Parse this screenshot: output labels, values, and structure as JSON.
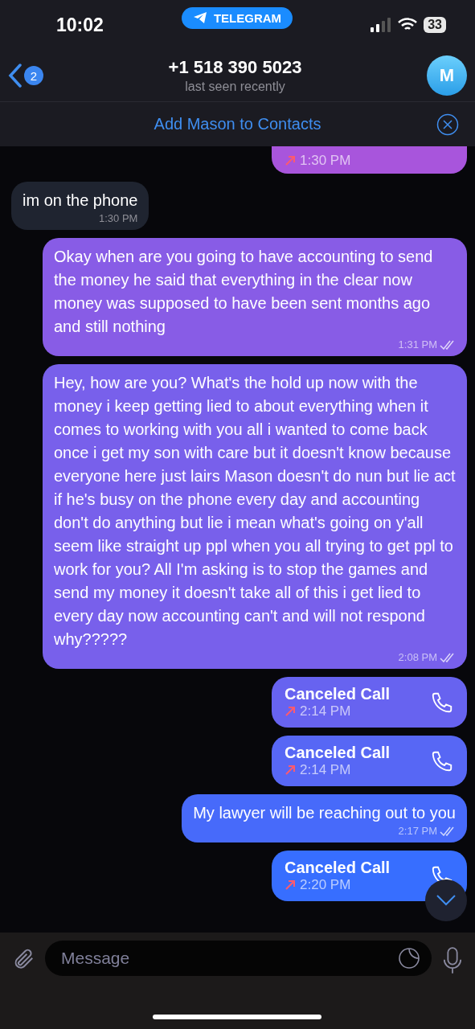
{
  "status_bar": {
    "time": "10:02",
    "app_pill": "TELEGRAM",
    "battery": "33"
  },
  "header": {
    "back_badge": "2",
    "title": "+1 518 390 5023",
    "subtitle": "last seen recently",
    "avatar_letter": "M"
  },
  "banner": {
    "text": "Add Mason to Contacts"
  },
  "messages": [
    {
      "kind": "call_cut",
      "outgoing": true,
      "time": "1:30 PM"
    },
    {
      "kind": "text",
      "outgoing": false,
      "text": "im on the phone",
      "time": "1:30 PM"
    },
    {
      "kind": "text",
      "outgoing": true,
      "text": "Okay when are you going to have accounting to send the money he said that everything in the clear now money was supposed to have been sent months ago and still nothing",
      "time": "1:31 PM",
      "read": true
    },
    {
      "kind": "text",
      "outgoing": true,
      "text": "Hey, how are you? What's the hold up now with the money i keep getting lied to about everything when it comes to working with you all i wanted to come back once i get my son with care but it doesn't know because everyone here just lairs Mason doesn't do nun but lie act if he's busy on the phone every day and accounting don't do anything but lie i mean what's going on y'all seem like straight up ppl when you all trying to get ppl to work for you? All I'm asking is to stop the games and send my money it doesn't take all of this i get lied to every day now accounting can't and will not respond why?????",
      "time": "2:08 PM",
      "read": true
    },
    {
      "kind": "call",
      "outgoing": true,
      "title": "Canceled Call",
      "time": "2:14 PM"
    },
    {
      "kind": "call",
      "outgoing": true,
      "title": "Canceled Call",
      "time": "2:14 PM"
    },
    {
      "kind": "text",
      "outgoing": true,
      "text": "My lawyer will be reaching out to you",
      "time": "2:17 PM",
      "read": true
    },
    {
      "kind": "call",
      "outgoing": true,
      "title": "Canceled Call",
      "time": "2:20 PM"
    }
  ],
  "composer": {
    "placeholder": "Message"
  }
}
